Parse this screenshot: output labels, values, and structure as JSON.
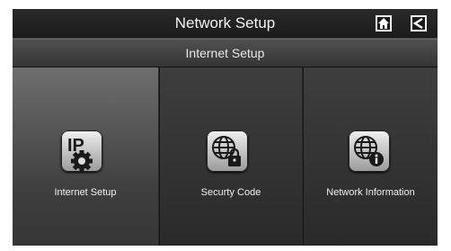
{
  "header": {
    "title": "Network Setup",
    "home_icon": "home-icon",
    "back_icon": "back-arrow-icon"
  },
  "subheader": {
    "title": "Internet Setup"
  },
  "options": [
    {
      "label": "Internet Setup",
      "icon": "ip-gear-icon",
      "selected": true
    },
    {
      "label": "Securty Code",
      "icon": "globe-lock-icon",
      "selected": false
    },
    {
      "label": "Network Information",
      "icon": "globe-info-icon",
      "selected": false
    }
  ],
  "colors": {
    "background": "#2b2b2b",
    "selected_panel": "#6e6e6e",
    "text": "#f0f0f0"
  }
}
